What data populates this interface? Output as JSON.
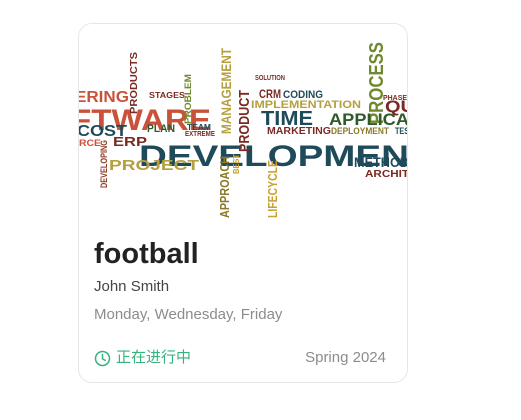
{
  "course": {
    "title": "football",
    "teacher": "John Smith",
    "schedule": "Monday, Wednesday, Friday",
    "status": "正在进行中",
    "term": "Spring 2024",
    "status_color": "#36b37e"
  },
  "cover": {
    "icon": "word-cloud-image",
    "words": [
      "DEVELOPMEN",
      "FTWARE",
      "PROJECT",
      "PROCESS",
      "APPLICA",
      "TIME",
      "IMPLEMENTATION",
      "MANAGEMENT",
      "PRODUCT",
      "APPROACH",
      "LIFECYCLE",
      "METHOD",
      "ARCHIT",
      "COST",
      "ERP",
      "PLAN",
      "MARKETING",
      "DEPLOYMENT",
      "CRM",
      "CODING",
      "PRODUCTS",
      "PROBLEM",
      "DEVELOPING",
      "SOLUTION",
      "ERING",
      "QU",
      "TEAM",
      "STAGES",
      "BEST",
      "EXTREME",
      "TES",
      "RCE",
      "PHASE"
    ]
  }
}
